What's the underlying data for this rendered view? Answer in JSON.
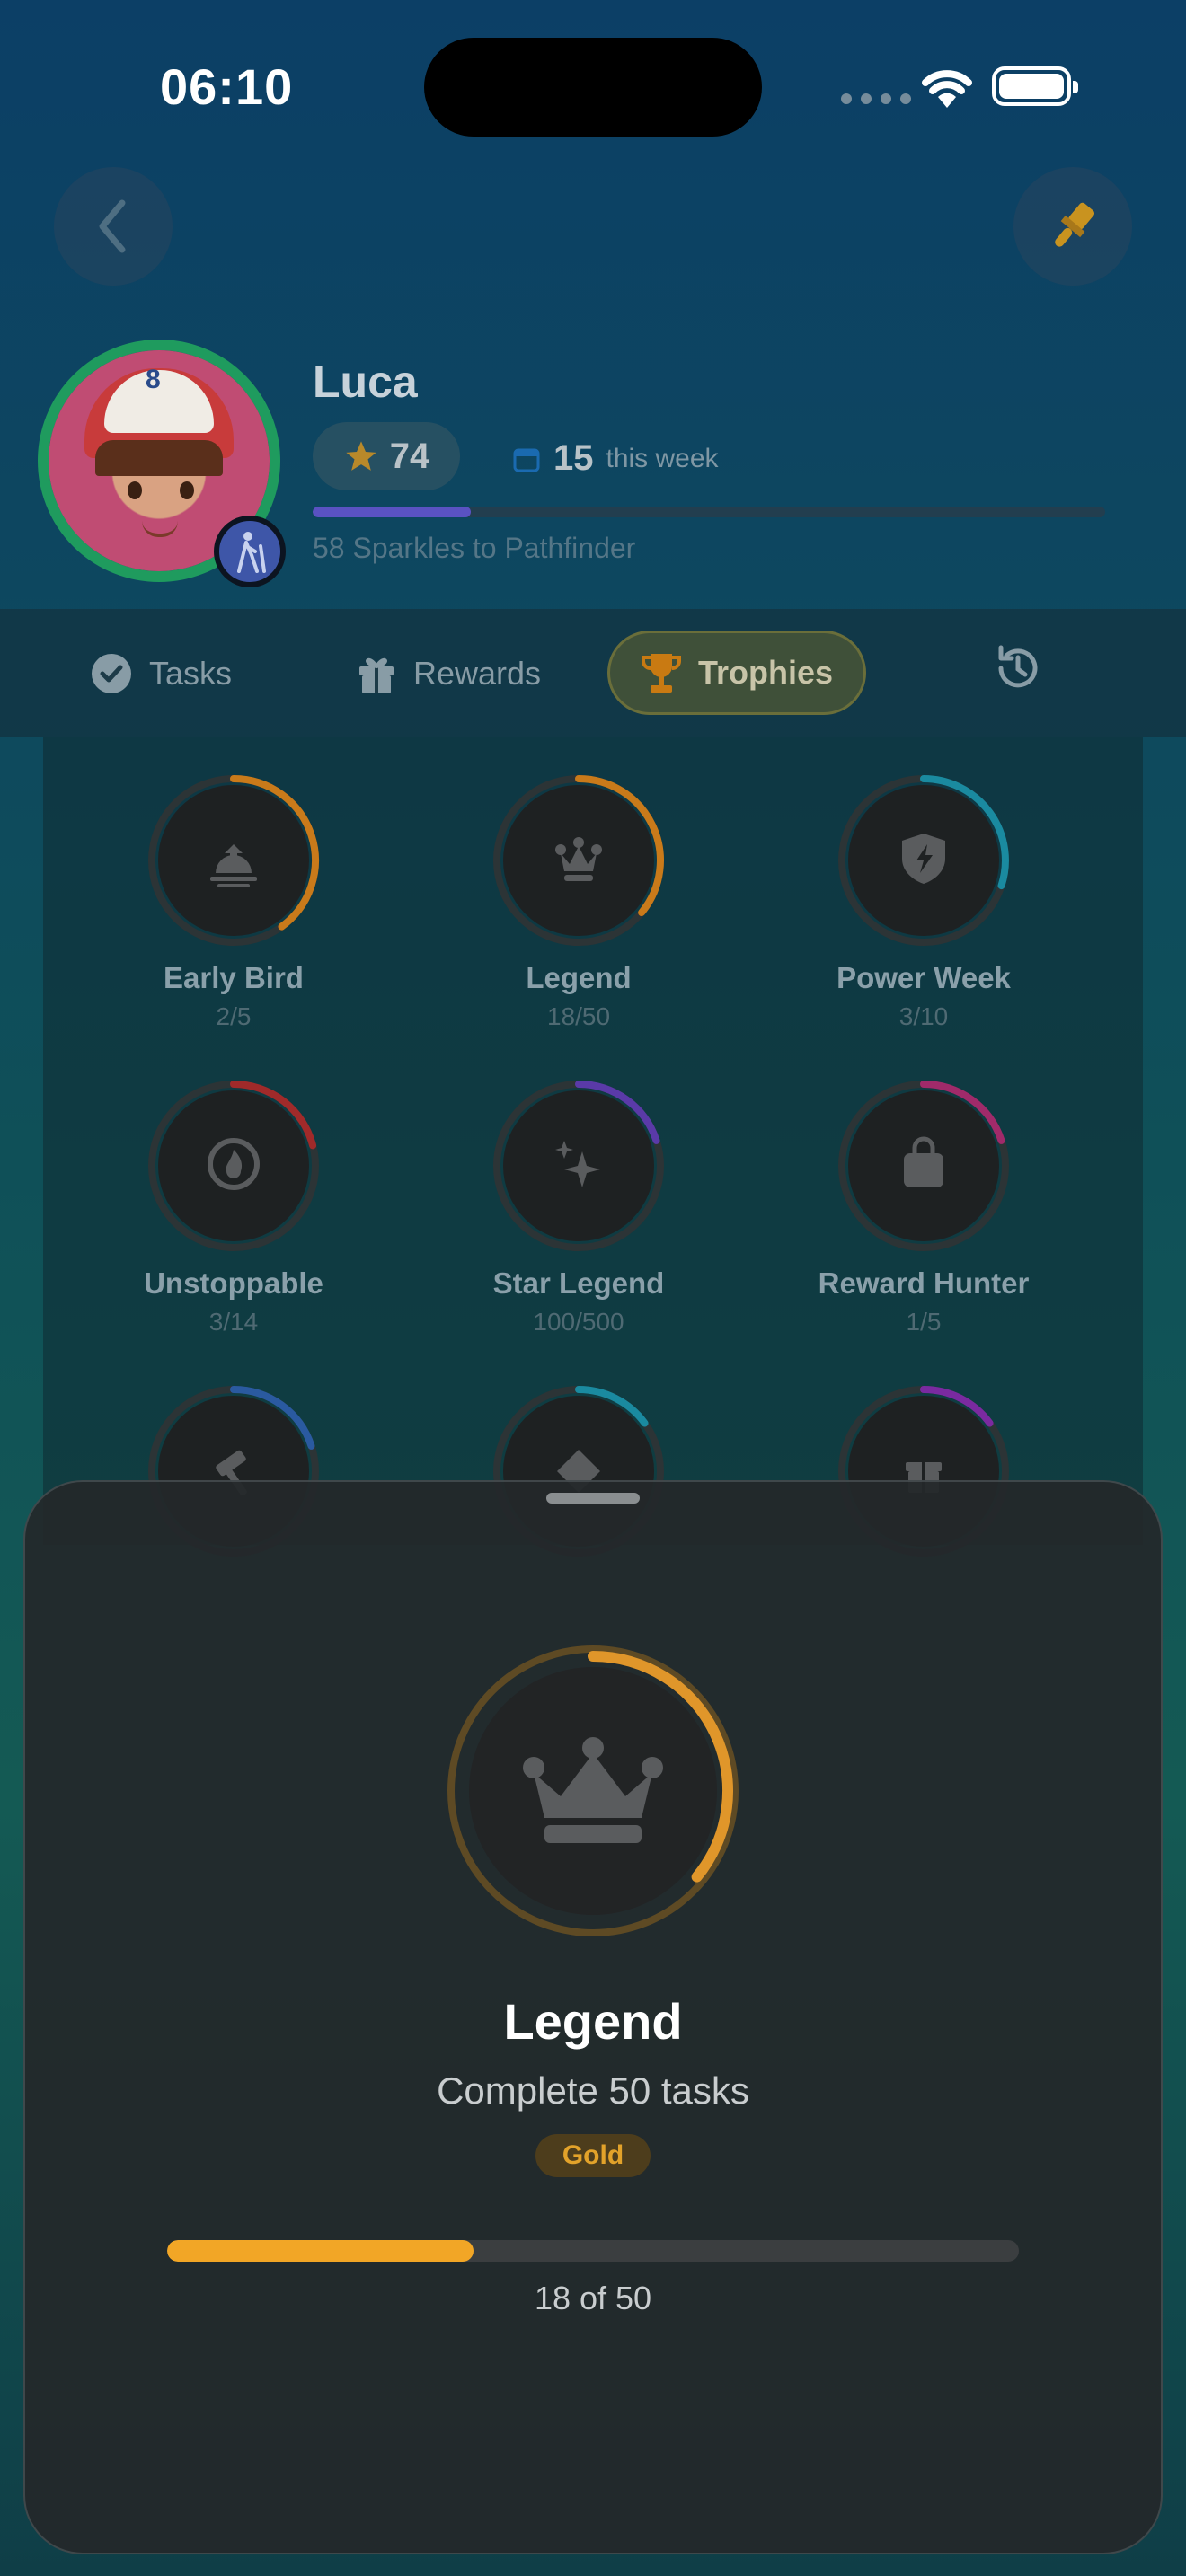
{
  "status": {
    "time": "06:10"
  },
  "profile": {
    "name": "Luca",
    "stars": "74",
    "week_count": "15",
    "week_label": "this week",
    "level_progress": 0.2,
    "level_text": "58 Sparkles to Pathfinder"
  },
  "tabs": [
    {
      "label": "Tasks",
      "icon": "check-circle-icon"
    },
    {
      "label": "Rewards",
      "icon": "gift-icon"
    },
    {
      "label": "Trophies",
      "icon": "trophy-icon",
      "selected": true
    },
    {
      "label": "",
      "icon": "history-icon"
    }
  ],
  "trophies": [
    {
      "name": "Early Bird",
      "progress": "2/5",
      "color": "#c97a1a",
      "icon": "sunrise-icon"
    },
    {
      "name": "Legend",
      "progress": "18/50",
      "color": "#c97a1a",
      "icon": "crown-icon"
    },
    {
      "name": "Power Week",
      "progress": "3/10",
      "color": "#1a8aa0",
      "icon": "bolt-shield-icon"
    },
    {
      "name": "Unstoppable",
      "progress": "3/14",
      "color": "#a02a2a",
      "icon": "flame-icon"
    },
    {
      "name": "Star Legend",
      "progress": "100/500",
      "color": "#5a3aa8",
      "icon": "sparkles-icon"
    },
    {
      "name": "Reward Hunter",
      "progress": "1/5",
      "color": "#a02a6a",
      "icon": "bag-icon"
    },
    {
      "name": "",
      "progress": "",
      "color": "#2a5aa0",
      "icon": "hammer-icon"
    },
    {
      "name": "",
      "progress": "",
      "color": "#1a8aa0",
      "icon": "diamond-icon"
    },
    {
      "name": "",
      "progress": "",
      "color": "#7a2aa0",
      "icon": "gift-icon"
    }
  ],
  "detail": {
    "name": "Legend",
    "description": "Complete 50 tasks",
    "tier": "Gold",
    "progress": 0.36,
    "count_text": "18 of 50",
    "ring_color": "#e0962a"
  }
}
